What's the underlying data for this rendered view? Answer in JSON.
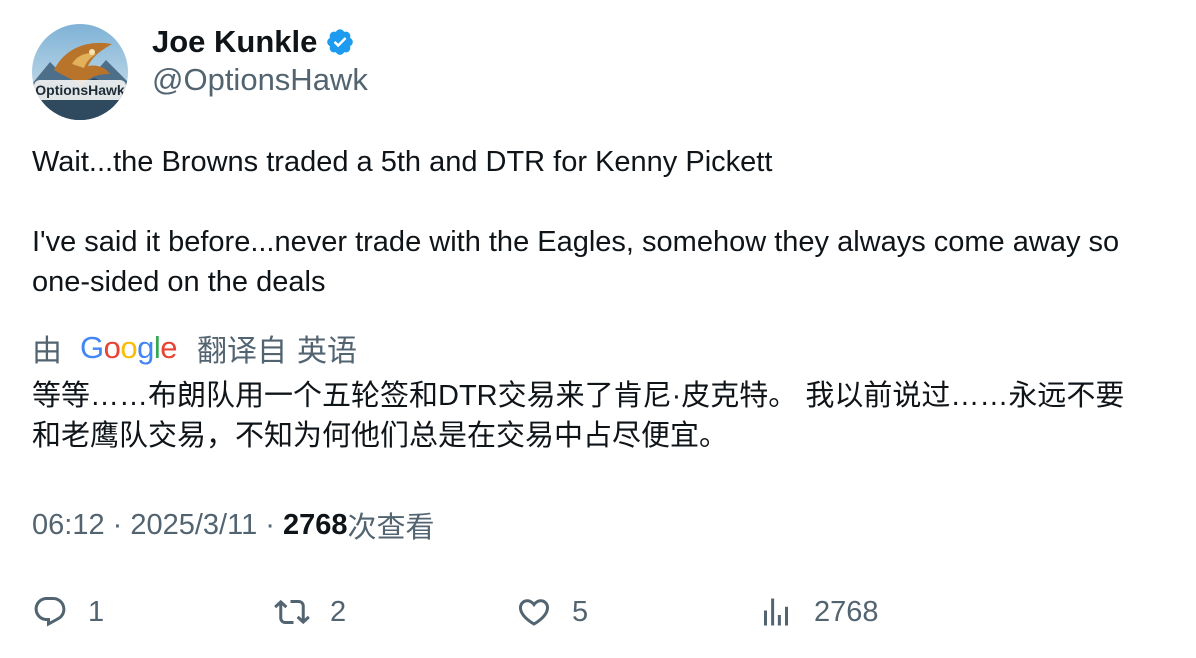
{
  "author": {
    "display_name": "Joe Kunkle",
    "handle": "@OptionsHawk",
    "verified": true,
    "avatar_icon": "hawk-logo-avatar",
    "avatar_text": "OptionsHawk"
  },
  "tweet": {
    "paragraphs": [
      "Wait...the Browns traded a 5th and DTR for Kenny Pickett",
      "I've said it before...never trade with the Eagles, somehow they always come away so one-sided on the deals"
    ]
  },
  "translation": {
    "by_label": "由",
    "provider": "Google",
    "from_label": "翻译自",
    "language": "英语",
    "text": "等等……布朗队用一个五轮签和DTR交易来了肯尼·皮克特。 我以前说过……永远不要和老鹰队交易，不知为何他们总是在交易中占尽便宜。"
  },
  "meta": {
    "time": "06:12",
    "separator": " · ",
    "date": "2025/3/11",
    "views_count": "2768",
    "views_label": "次查看"
  },
  "actions": {
    "replies": "1",
    "retweets": "2",
    "likes": "5",
    "views": "2768"
  },
  "colors": {
    "text_primary": "#0f1419",
    "text_secondary": "#536471",
    "verified_blue": "#1d9bf0"
  }
}
